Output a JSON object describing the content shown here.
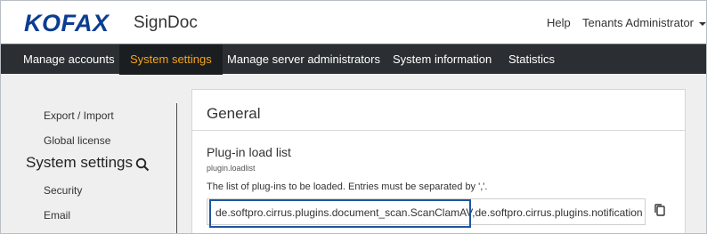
{
  "header": {
    "logo": "KOFAX",
    "product": "SignDoc",
    "help": "Help",
    "user_menu": "Tenants Administrator"
  },
  "nav": {
    "items": [
      {
        "label": "Manage accounts"
      },
      {
        "label": "System settings",
        "active": true
      },
      {
        "label": "Manage server administrators"
      },
      {
        "label": "System information"
      },
      {
        "label": "Statistics"
      }
    ]
  },
  "sidebar": {
    "items": [
      {
        "label": "Export / Import"
      },
      {
        "label": "Global license"
      },
      {
        "label": "Security"
      },
      {
        "label": "Email"
      }
    ],
    "heading": "System settings",
    "search_icon": "search-icon"
  },
  "content": {
    "title": "General",
    "field": {
      "label": "Plug-in load list",
      "key": "plugin.loadlist",
      "description": "The list of plug-ins to be loaded. Entries must be separated by ','.",
      "value": "de.softpro.cirrus.plugins.document_scan.ScanClamAV,de.softpro.cirrus.plugins.notification"
    },
    "copy_icon": "copy-icon"
  },
  "colors": {
    "brand": "#0b3d91",
    "nav_bg": "#2b2f33",
    "nav_active": "#f3a51c",
    "highlight": "#1e56a0"
  }
}
